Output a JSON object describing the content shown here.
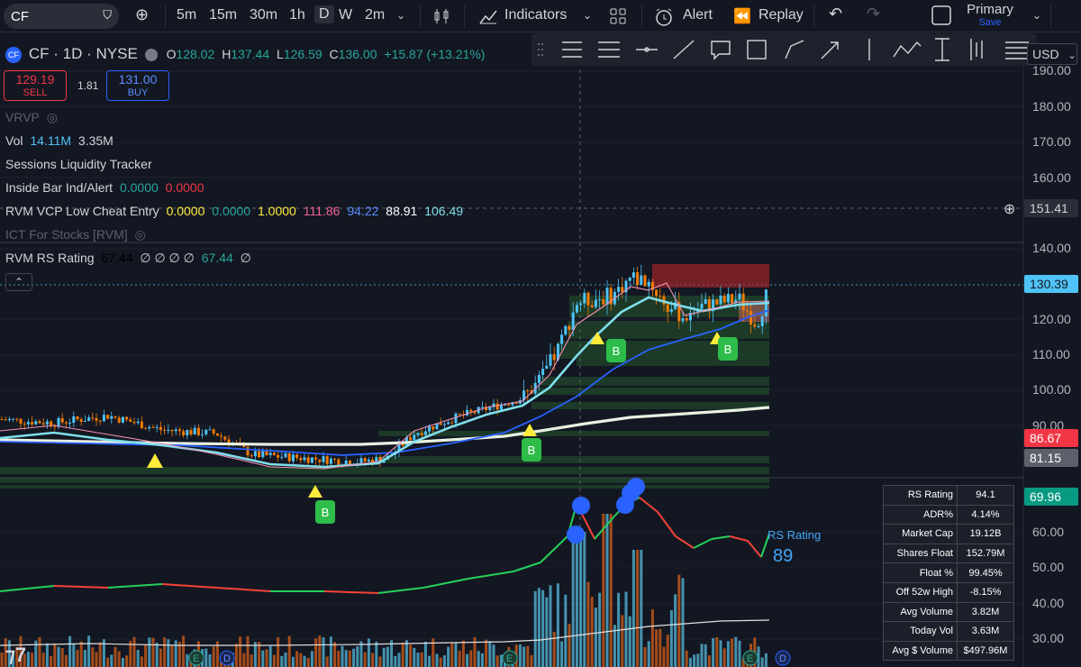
{
  "topbar": {
    "symbol": "CF",
    "intervals": [
      "5m",
      "15m",
      "30m",
      "1h",
      "D",
      "W",
      "2m"
    ],
    "active_interval": "D",
    "indicators_label": "Indicators",
    "alert_label": "Alert",
    "replay_label": "Replay",
    "layout_name": "Primary",
    "save_label": "Save"
  },
  "legend": {
    "symbol_line": "CF · 1D · NYSE",
    "badge": "CF",
    "ohlc": {
      "o_label": "O",
      "o": "128.02",
      "h_label": "H",
      "h": "137.44",
      "l_label": "L",
      "l": "126.59",
      "c_label": "C",
      "c": "136.00",
      "change": "+15.87 (+13.21%)"
    },
    "sell_price": "129.19",
    "sell_label": "SELL",
    "spread": "1.81",
    "buy_price": "131.00",
    "buy_label": "BUY",
    "indicators": {
      "vrvp": "VRVP",
      "vol_label": "Vol",
      "vol1": "14.11M",
      "vol2": "3.35M",
      "sessions": "Sessions Liquidity Tracker",
      "inside_bar": "Inside Bar Ind/Alert",
      "ib1": "0.0000",
      "ib2": "0.0000",
      "vcp": "RVM VCP Low Cheat Entry",
      "vcp1": "0.0000",
      "vcp2": "0.0000",
      "vcp3": "1.0000",
      "vcp4": "111.86",
      "vcp5": "94.22",
      "vcp6": "88.91",
      "vcp7": "106.49",
      "ict": "ICT For Stocks [RVM]",
      "rs": "RVM RS Rating",
      "rs1": "67.44",
      "rs_nulls": "∅ ∅ ∅ ∅",
      "rs2": "67.44",
      "rs_null_end": "∅"
    }
  },
  "axis": {
    "currency": "USD",
    "ticks": [
      "190.00",
      "180.00",
      "170.00",
      "160.00",
      "150.00",
      "140.00",
      "130.00",
      "120.00",
      "110.00",
      "100.00",
      "90.00",
      "80.00",
      "70.00",
      "60.00",
      "50.00",
      "40.00",
      "30.00"
    ],
    "crosshair_price": "151.41",
    "last_price": "130.39",
    "red_label": "86.67",
    "gray_label": "81.15",
    "green_label": "69.96",
    "colors": {
      "last": "#4fc3f7",
      "red": "#f23645",
      "gray": "#5d606b",
      "green": "#089981"
    }
  },
  "stats": [
    [
      "RS Rating",
      "94.1"
    ],
    [
      "ADR%",
      "4.14%"
    ],
    [
      "Market Cap",
      "19.12B"
    ],
    [
      "Shares Float",
      "152.79M"
    ],
    [
      "Float %",
      "99.45%"
    ],
    [
      "Off 52w High",
      "-8.15%"
    ],
    [
      "Avg Volume",
      "3.82M"
    ],
    [
      "Today Vol",
      "3.63M"
    ],
    [
      "Avg $ Volume",
      "$497.96M"
    ]
  ],
  "rs_panel": {
    "label": "RS Rating",
    "value": "89"
  },
  "markers": {
    "buy": "B",
    "earnings": "E",
    "dividend": "D"
  },
  "chart_data": {
    "type": "candlestick",
    "ylim": [
      25,
      190
    ],
    "price_path": [
      [
        0,
        92
      ],
      [
        60,
        91
      ],
      [
        120,
        93
      ],
      [
        180,
        89
      ],
      [
        240,
        88
      ],
      [
        280,
        82
      ],
      [
        340,
        81
      ],
      [
        400,
        80
      ],
      [
        430,
        81
      ],
      [
        460,
        88
      ],
      [
        500,
        92
      ],
      [
        540,
        95
      ],
      [
        580,
        98
      ],
      [
        600,
        103
      ],
      [
        620,
        112
      ],
      [
        640,
        125
      ],
      [
        660,
        126
      ],
      [
        680,
        127
      ],
      [
        700,
        132
      ],
      [
        720,
        131
      ],
      [
        740,
        124
      ],
      [
        760,
        121
      ],
      [
        780,
        124
      ],
      [
        800,
        125
      ],
      [
        820,
        126
      ],
      [
        840,
        119
      ],
      [
        855,
        130
      ]
    ]
  }
}
